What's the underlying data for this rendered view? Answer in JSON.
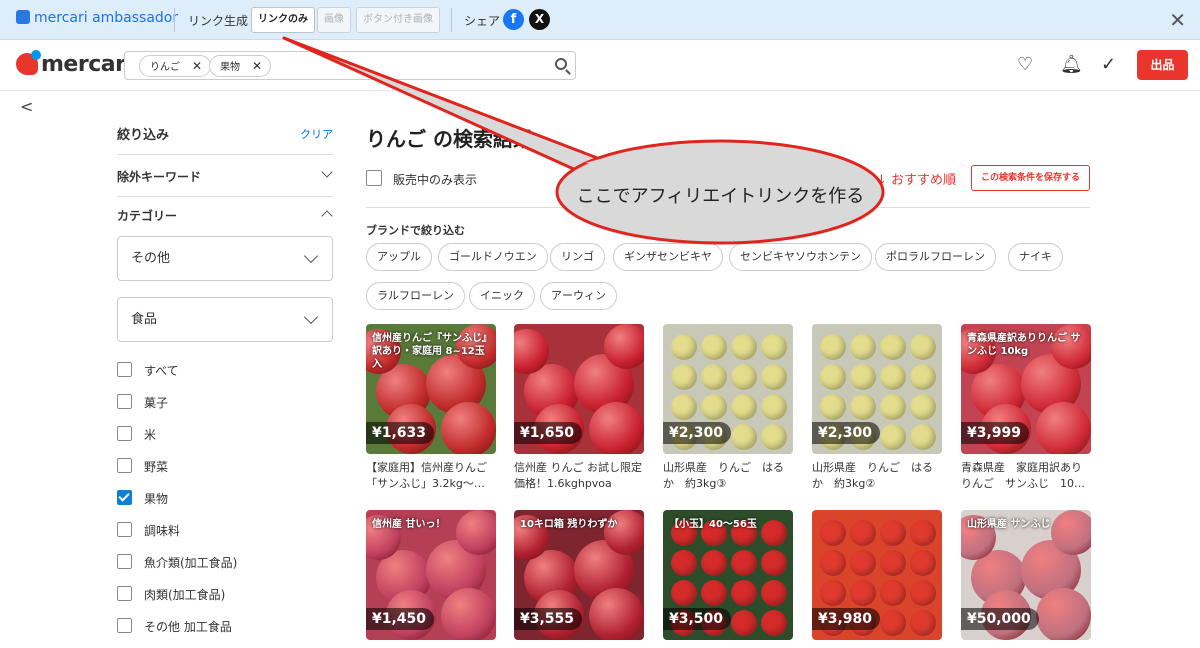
{
  "ambassador_bar": {
    "logo_text": "mercari ambassador",
    "link_gen_label": "リンク生成",
    "link_only_btn": "リンクのみ",
    "image_btn": "画像",
    "button_image_btn": "ボタン付き画像",
    "share_label": "シェア",
    "close": "✕"
  },
  "header": {
    "logo": "mercari",
    "chips": [
      "りんご",
      "果物"
    ],
    "sell_label": "出品"
  },
  "sidebar": {
    "title": "絞り込み",
    "clear": "クリア",
    "exclude_keyword": "除外キーワード",
    "category": "カテゴリー",
    "select1": "その他",
    "select2": "食品",
    "checkboxes": [
      {
        "label": "すべて",
        "checked": false
      },
      {
        "label": "菓子",
        "checked": false
      },
      {
        "label": "米",
        "checked": false
      },
      {
        "label": "野菜",
        "checked": false
      },
      {
        "label": "果物",
        "checked": true
      },
      {
        "label": "調味料",
        "checked": false
      },
      {
        "label": "魚介類(加工食品)",
        "checked": false
      },
      {
        "label": "肉類(加工食品)",
        "checked": false
      },
      {
        "label": "その他 加工食品",
        "checked": false
      }
    ]
  },
  "main": {
    "title": "りんご の検索結果",
    "on_sale_only": "販売中のみ表示",
    "sort": "↓ おすすめ順",
    "save_search": "この検索条件を保存する",
    "brand_header": "ブランドで絞り込む",
    "brands": [
      "アップル",
      "ゴールドノウエン",
      "リンゴ",
      "ギンザセンビキヤ",
      "センビキヤソウホンテン",
      "ポロラルフローレン",
      "ナイキ",
      "ラルフローレン",
      "イニック",
      "アーウィン"
    ]
  },
  "items": [
    {
      "price": "¥1,633",
      "title": "【家庭用】信州産りんご「サンふじ」3.2kg〜…",
      "overlay": "信州産りんご『サンふじ』訳あり・家庭用 8~12玉入"
    },
    {
      "price": "¥1,650",
      "title": "信州産 りんご お試し限定価格！1.6kghpvoa",
      "overlay": ""
    },
    {
      "price": "¥2,300",
      "title": "山形県産　りんご　はるか　約3kg③",
      "overlay": ""
    },
    {
      "price": "¥2,300",
      "title": "山形県産　りんご　はるか　約3kg②",
      "overlay": ""
    },
    {
      "price": "¥3,999",
      "title": "青森県産　家庭用訳ありりんご　サンふじ　10…",
      "overlay": "青森県産訳ありりんご サンふじ 10kg"
    },
    {
      "price": "¥1,450",
      "title": "",
      "overlay": "信州産 甘いっ！"
    },
    {
      "price": "¥3,555",
      "title": "",
      "overlay": "10キロ箱 残りわずか"
    },
    {
      "price": "¥3,500",
      "title": "",
      "overlay": "【小玉】40〜56玉"
    },
    {
      "price": "¥3,980",
      "title": "",
      "overlay": ""
    },
    {
      "price": "¥50,000",
      "title": "",
      "overlay": "山形県産 サンふじ"
    }
  ],
  "callout": {
    "text": "ここでアフィリエイトリンクを作る"
  },
  "colors": {
    "accent": "#ea352d",
    "link": "#0073cc",
    "callout_border": "#e0251e"
  }
}
